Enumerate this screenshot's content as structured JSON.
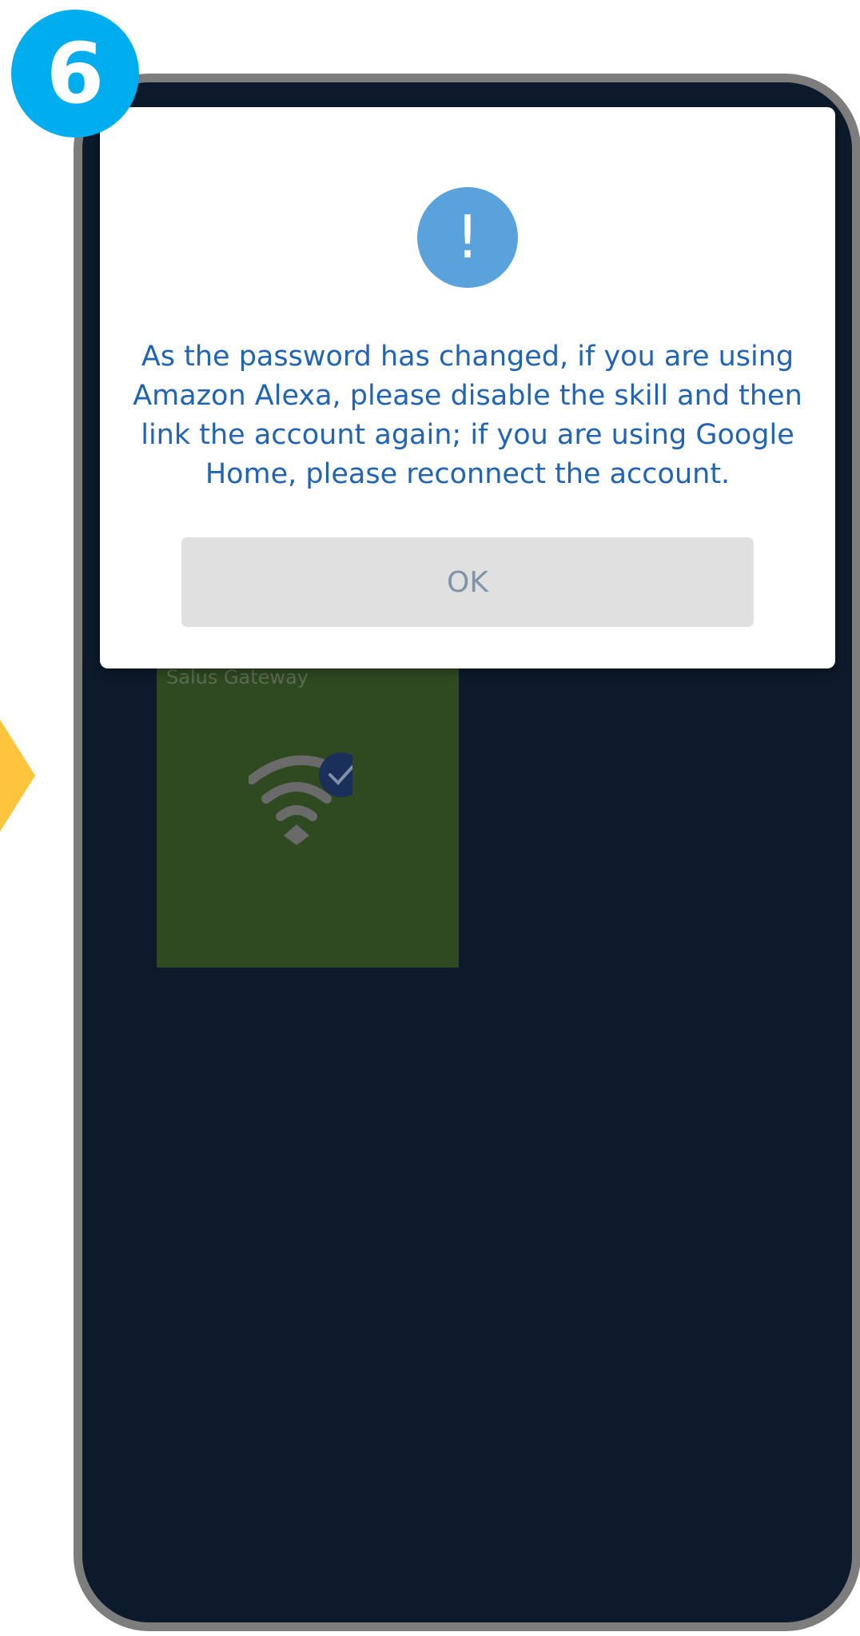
{
  "step": {
    "number": "6"
  },
  "background_screen": {
    "gateway_tile": {
      "label": "Salus Gateway",
      "icon": "wifi-connected-icon",
      "color": "#2f4a21"
    }
  },
  "dialog": {
    "icon": "alert-icon",
    "icon_glyph": "!",
    "message": "As the password has changed, if you are using Amazon Alexa, please disable the skill and then link the account again; if you are using Google Home, please reconnect the account.",
    "ok_label": "OK"
  },
  "colors": {
    "badge": "#00aeef",
    "alert_icon": "#59a2db",
    "message_text": "#2164b4",
    "ok_button_bg": "#dfe0df",
    "ok_button_text": "#7f93a9",
    "phone_screen": "#0c1a2b",
    "phone_frame": "#7d7d7d",
    "side_arrow": "#ffc43d"
  }
}
